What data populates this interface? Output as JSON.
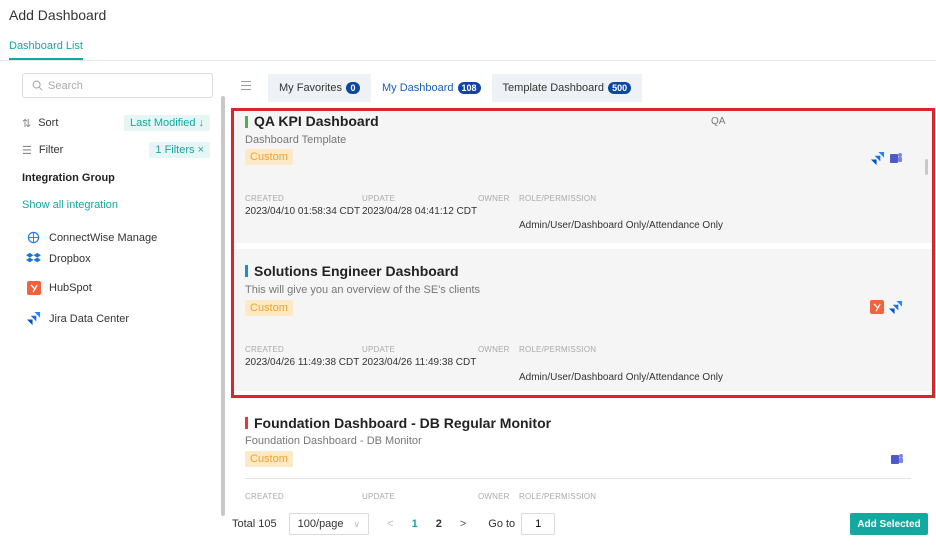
{
  "page": {
    "title": "Add Dashboard",
    "tab": "Dashboard List"
  },
  "sidebar": {
    "search_placeholder": "Search",
    "sort_label": "Sort",
    "sort_value": "Last Modified ↓",
    "filter_label": "Filter",
    "filter_value": "1 Filters ×",
    "group_title": "Integration Group",
    "show_all": "Show all integration",
    "integrations": [
      {
        "label": "ConnectWise Manage",
        "icon": "connectwise-icon"
      },
      {
        "label": "Dropbox",
        "icon": "dropbox-icon"
      },
      {
        "label": "HubSpot",
        "icon": "hubspot-icon"
      },
      {
        "label": "Jira Data Center",
        "icon": "jira-icon"
      }
    ]
  },
  "tabs": [
    {
      "label": "My Favorites",
      "count": "0"
    },
    {
      "label": "My Dashboard",
      "count": "108"
    },
    {
      "label": "Template Dashboard",
      "count": "500"
    }
  ],
  "meta_headers": {
    "created": "CREATED",
    "update": "UPDATE",
    "owner": "OWNER",
    "role": "ROLE/PERMISSION"
  },
  "cards": [
    {
      "title": "QA KPI Dashboard",
      "subtitle": "Dashboard Template",
      "tag": "Custom",
      "right_label": "QA",
      "accent": "#4caf50",
      "created": "2023/04/10 01:58:34 CDT",
      "updated": "2023/04/28 04:41:12 CDT",
      "role": "Admin/User/Dashboard Only/Attendance Only"
    },
    {
      "title": "Solutions Engineer Dashboard",
      "subtitle": "This will give you an overview of the SE's clients",
      "tag": "Custom",
      "accent": "#1e88e5",
      "created": "2023/04/26 11:49:38 CDT",
      "updated": "2023/04/26 11:49:38 CDT",
      "role": "Admin/User/Dashboard Only/Attendance Only"
    },
    {
      "title": "Foundation Dashboard - DB Regular Monitor",
      "subtitle": "Foundation Dashboard - DB Monitor",
      "tag": "Custom",
      "accent": "#e53935"
    }
  ],
  "pagination": {
    "total": "Total 105",
    "per_page": "100/page",
    "prev": "<",
    "pages": [
      "1",
      "2"
    ],
    "next": ">",
    "goto_label": "Go to",
    "goto_value": "1"
  },
  "add_button": "Add Selected",
  "colors": {
    "accent": "#13a8a0",
    "highlight": "#d8262f",
    "badge": "#0d47a1"
  }
}
